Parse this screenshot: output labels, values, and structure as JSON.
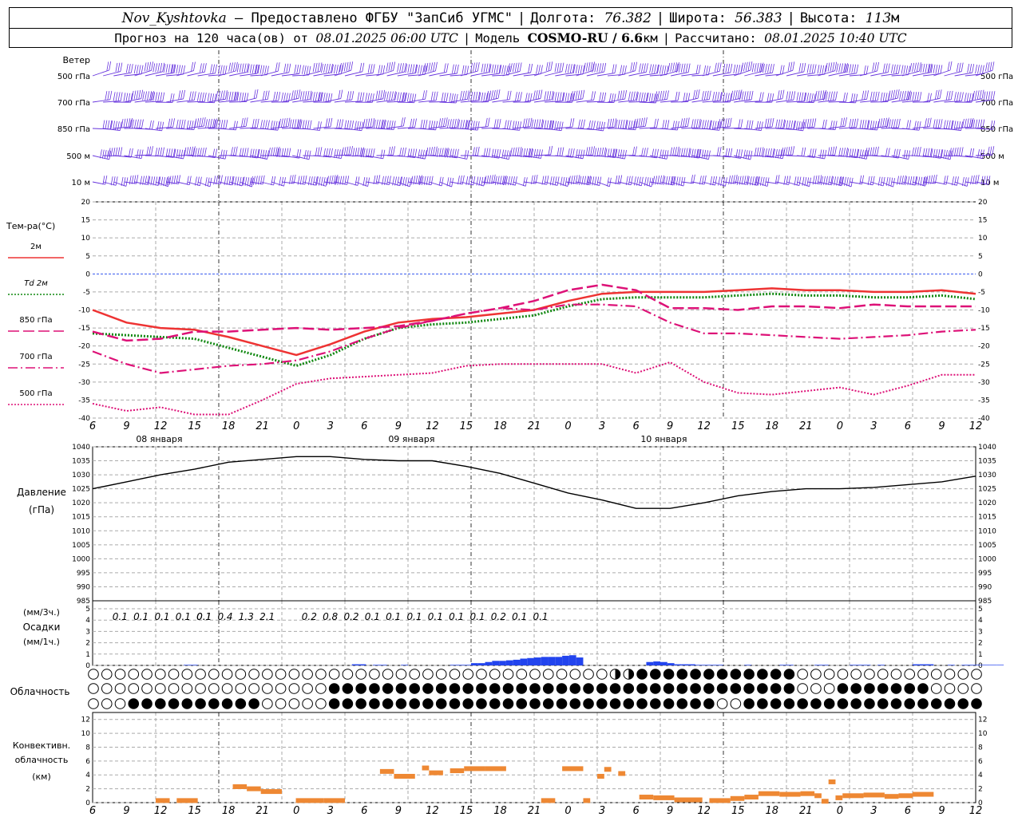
{
  "header": {
    "station": "Nov_Kyshtovka",
    "provider": "— Предоставлено ФГБУ \"ЗапСиб УГМС\"",
    "lon_label": "Долгота:",
    "lon": "76.382",
    "lat_label": "Широта:",
    "lat": "56.383",
    "alt_label": "Высота:",
    "alt": "113",
    "alt_unit": "м",
    "forecast_label": "Прогноз на 120 часа(ов) от",
    "forecast_start": "08.01.2025 06:00 UTC",
    "model_label": "Модель",
    "model": "COSMO-RU / 6.6",
    "model_unit": "км",
    "calc_label": "Рассчитано:",
    "calc_time": "08.01.2025 10:40 UTC"
  },
  "chart_data": [
    {
      "type": "barbs",
      "panel": "wind",
      "title": "Ветер",
      "levels": [
        "500 гПа",
        "700 гПа",
        "850 гПа",
        "500 м",
        "10  м"
      ],
      "x_hours": [
        6,
        9,
        12,
        15,
        18,
        21,
        0,
        3,
        6,
        9,
        12,
        15,
        18,
        21,
        0,
        3,
        6,
        9,
        12,
        15,
        18,
        21,
        0,
        3,
        6,
        9,
        12
      ]
    },
    {
      "type": "line",
      "panel": "temperature",
      "title": "Тем-ра(°С)",
      "ylim": [
        -40,
        20
      ],
      "yticks": [
        20,
        15,
        10,
        5,
        0,
        -5,
        -10,
        -15,
        -20,
        -25,
        -30,
        -35,
        -40
      ],
      "x_hours": [
        6,
        9,
        12,
        15,
        18,
        21,
        0,
        3,
        6,
        9,
        12,
        15,
        18,
        21,
        0,
        3,
        6,
        9,
        12,
        15,
        18,
        21,
        0,
        3,
        6,
        9,
        12
      ],
      "day_labels": [
        "08 января",
        "09 января",
        "10 января"
      ],
      "series": [
        {
          "name": "2м",
          "color": "#ee3333",
          "style": "solid",
          "values": [
            -10,
            -13.5,
            -15,
            -15.5,
            -17.5,
            -20,
            -22.5,
            -19.5,
            -16,
            -13.5,
            -12.5,
            -12,
            -11,
            -10,
            -7.5,
            -5.5,
            -5,
            -5,
            -5,
            -4.5,
            -4,
            -4.5,
            -4.5,
            -5,
            -5,
            -4.5,
            -5.5
          ]
        },
        {
          "name": "Td 2м",
          "color": "#118811",
          "style": "dotted",
          "values": [
            -16.5,
            -17,
            -17.5,
            -18,
            -20.5,
            -23,
            -25.5,
            -22.5,
            -18,
            -15,
            -14,
            -13.5,
            -12.5,
            -11.5,
            -9,
            -7,
            -6.5,
            -6.5,
            -6.5,
            -6,
            -5.5,
            -6,
            -6,
            -6.5,
            -6.5,
            -6,
            -7
          ]
        },
        {
          "name": "850 гПа",
          "color": "#dd1177",
          "style": "longdash",
          "values": [
            -16,
            -18.5,
            -18,
            -16,
            -16,
            -15.5,
            -15,
            -15.5,
            -15,
            -14.5,
            -13,
            -11,
            -9.5,
            -7.5,
            -4.5,
            -3,
            -4.5,
            -9.5,
            -9.5,
            -10,
            -9,
            -9,
            -9.5,
            -8.5,
            -9,
            -9,
            -9
          ]
        },
        {
          "name": "700 гПа",
          "color": "#dd1177",
          "style": "dashdot",
          "values": [
            -21.5,
            -25,
            -27.5,
            -26.5,
            -25.5,
            -25,
            -24,
            -21.5,
            -18,
            -15,
            -13,
            -11,
            -9.5,
            -10,
            -8.5,
            -8.5,
            -9,
            -13.5,
            -16.5,
            -16.5,
            -17,
            -17.5,
            -18,
            -17.5,
            -17,
            -16,
            -15.5
          ]
        },
        {
          "name": "500 гПа",
          "color": "#dd1177",
          "style": "dotted",
          "values": [
            -36,
            -38,
            -37,
            -39,
            -39,
            -35,
            -30.5,
            -29,
            -28.5,
            -28,
            -27.5,
            -25.5,
            -25,
            -25,
            -25,
            -25,
            -27.5,
            -24.5,
            -30,
            -33,
            -33.5,
            -32.5,
            -31.5,
            -33.5,
            -31,
            -28,
            -28
          ]
        }
      ]
    },
    {
      "type": "line",
      "panel": "pressure",
      "title": "Давление",
      "unit": "(гПа)",
      "ylim": [
        985,
        1040
      ],
      "yticks": [
        1040,
        1035,
        1030,
        1025,
        1020,
        1015,
        1010,
        1005,
        1000,
        995,
        990,
        985
      ],
      "series": [
        {
          "name": "Давление",
          "color": "#000000",
          "values": [
            1025,
            1027.5,
            1030,
            1032,
            1034.5,
            1035.5,
            1036.5,
            1036.5,
            1035.5,
            1035,
            1035,
            1033,
            1030.5,
            1027,
            1023.5,
            1021,
            1018,
            1018,
            1020,
            1022.5,
            1024,
            1025,
            1025,
            1025.5,
            1026.5,
            1027.5,
            1029.5
          ]
        }
      ]
    },
    {
      "type": "bar",
      "panel": "precipitation",
      "title": "Осадки",
      "unit_3h": "(мм/3ч.)",
      "unit_1h": "(мм/1ч.)",
      "ylim": [
        0,
        5
      ],
      "yticks": [
        5,
        4,
        3,
        2,
        1,
        0
      ],
      "color": "#2244ee",
      "hourly": [
        0,
        0,
        0,
        0,
        0,
        0,
        0,
        0,
        0,
        0,
        0,
        0,
        0,
        0.05,
        0.05,
        0,
        0,
        0,
        0,
        0,
        0,
        0,
        0,
        0,
        0,
        0,
        0,
        0,
        0,
        0,
        0,
        0,
        0,
        0,
        0,
        0,
        0,
        0.1,
        0.1,
        0,
        0.05,
        0.05,
        0,
        0,
        0.05,
        0,
        0,
        0,
        0,
        0,
        0,
        0.05,
        0.05,
        0.05,
        0.2,
        0.2,
        0.3,
        0.4,
        0.4,
        0.45,
        0.5,
        0.6,
        0.65,
        0.7,
        0.75,
        0.75,
        0.75,
        0.85,
        0.9,
        0.7,
        0,
        0,
        0,
        0,
        0,
        0,
        0,
        0,
        0,
        0.3,
        0.35,
        0.3,
        0.2,
        0.1,
        0.1,
        0.1,
        0.05,
        0.05,
        0.05,
        0.05,
        0,
        0,
        0,
        0.05,
        0,
        0,
        0,
        0,
        0.05,
        0.05,
        0,
        0,
        0,
        0.05,
        0.05,
        0,
        0,
        0,
        0.05,
        0.05,
        0.05,
        0,
        0.05,
        0,
        0,
        0,
        0,
        0.1,
        0.1,
        0.1,
        0,
        0,
        0.05,
        0,
        0.05,
        0.05,
        0.05,
        0.05,
        0.05,
        0.05
      ],
      "sums_3h": [
        "0.1",
        "0.1",
        "0.1",
        "0.1",
        "0.1",
        "0.1",
        "0.4",
        "1.3",
        "2.1",
        "0.2",
        "0.8",
        "0.2",
        "0.1",
        "0.1",
        "0.1",
        "0.1",
        "0.1",
        "0.1",
        "0.2",
        "0.1",
        "0.1"
      ],
      "sums_3h_hour": [
        12,
        15,
        3,
        6,
        9,
        15,
        18,
        21,
        24,
        30,
        33,
        36,
        39,
        42,
        45,
        48,
        51,
        54,
        57,
        60,
        63
      ]
    },
    {
      "type": "table",
      "panel": "cloudiness",
      "title": "Облачность",
      "rows": [
        [
          0,
          0,
          0,
          0,
          0,
          0,
          0,
          0,
          0,
          0,
          0,
          0,
          0,
          0,
          0,
          0,
          0,
          0,
          0,
          0,
          0,
          0,
          0,
          0,
          0,
          0,
          0,
          0,
          0,
          0,
          0,
          0,
          0,
          0,
          0,
          0,
          0,
          0,
          0,
          0,
          0,
          0,
          0,
          0,
          0,
          0,
          0,
          0,
          0,
          0,
          0,
          0,
          0,
          0,
          0,
          0,
          0,
          0,
          0,
          0,
          0,
          0,
          0,
          0,
          0,
          0,
          0,
          0,
          0,
          0,
          0,
          0,
          0,
          0,
          0,
          0,
          0,
          0,
          0,
          0,
          0,
          0,
          0,
          0,
          0,
          0,
          0,
          0,
          0,
          0,
          0,
          0,
          0,
          0,
          0,
          0,
          0,
          0,
          0,
          0,
          0,
          0,
          0,
          0,
          0,
          0,
          0,
          0,
          0,
          0,
          0,
          0,
          0,
          0,
          0,
          0,
          0,
          0,
          0,
          0,
          0,
          0,
          0,
          0,
          0,
          0
        ],
        [
          0,
          0,
          0,
          0,
          0,
          0,
          0,
          0,
          0,
          0,
          0,
          0,
          0,
          0,
          0,
          0,
          0,
          0,
          0,
          0,
          0,
          0,
          0,
          0,
          0,
          0,
          0,
          0,
          0,
          0,
          0,
          0,
          0,
          0,
          0,
          0,
          0,
          0,
          0,
          0,
          0,
          0,
          0,
          0,
          0,
          0,
          0,
          0,
          0,
          0,
          0,
          0,
          0,
          0,
          0,
          0,
          0,
          0,
          0,
          0,
          0,
          0,
          0,
          0,
          0,
          0,
          0,
          0,
          0,
          0,
          0,
          0,
          0,
          0,
          0,
          0,
          0,
          0,
          0,
          0,
          0,
          0,
          0,
          0,
          0,
          0,
          0,
          0,
          0,
          0,
          0,
          0,
          0,
          0,
          0,
          0,
          0,
          0,
          0,
          0,
          0,
          0,
          0,
          0,
          0,
          0,
          0,
          0,
          0,
          0,
          0,
          0,
          0,
          0,
          0,
          0,
          0,
          0,
          0,
          0,
          0,
          0,
          0,
          0,
          0,
          0
        ],
        [
          0,
          0,
          0,
          0,
          0,
          0,
          0,
          0,
          0,
          0,
          0,
          0,
          0,
          0,
          0,
          0,
          0,
          0,
          0,
          0,
          0,
          0,
          0,
          0,
          0,
          0,
          0,
          0,
          0,
          0,
          0,
          0,
          0,
          0,
          0,
          0,
          0,
          0,
          0,
          0,
          0,
          0,
          0,
          0,
          0,
          0,
          0,
          0,
          0,
          0,
          0,
          0,
          0,
          0,
          0,
          0,
          0,
          0,
          0,
          0,
          0,
          0,
          0,
          0,
          0,
          0,
          0,
          0,
          0,
          0,
          0,
          0,
          0,
          0,
          0,
          0,
          0,
          0,
          0,
          0,
          0,
          0,
          0,
          0,
          0,
          0,
          0,
          0,
          0,
          0,
          0,
          0,
          0,
          0,
          0,
          0,
          0,
          0,
          0,
          0,
          0,
          0,
          0,
          0,
          0,
          0,
          0,
          0,
          0,
          0,
          0,
          0,
          0,
          0,
          0,
          0,
          0,
          0,
          0,
          0,
          0,
          0,
          0,
          0,
          0,
          0
        ]
      ]
    },
    {
      "type": "bar",
      "panel": "convective",
      "title": "Конвективн.",
      "title2": "облачность",
      "unit": "(км)",
      "ylim": [
        0,
        13
      ],
      "yticks": [
        12,
        10,
        8,
        6,
        4,
        2,
        0
      ],
      "color": "#ee8833",
      "x_hours": [
        6,
        9,
        12,
        15,
        18,
        21,
        0,
        3,
        6,
        9,
        12,
        15,
        18,
        21,
        0,
        3,
        6,
        9,
        12,
        15,
        18,
        21,
        0,
        3,
        6,
        9,
        12
      ],
      "segments": [
        [
          9,
          11,
          0.3
        ],
        [
          12,
          15,
          0.3
        ],
        [
          20,
          22,
          2.3
        ],
        [
          22,
          24,
          2
        ],
        [
          24,
          27,
          1.6
        ],
        [
          29,
          33,
          0.3
        ],
        [
          33,
          36,
          0.3
        ],
        [
          41,
          43,
          4.5
        ],
        [
          43,
          46,
          3.8
        ],
        [
          47,
          48,
          5
        ],
        [
          48,
          50,
          4.3
        ],
        [
          51,
          53,
          4.6
        ],
        [
          53,
          56,
          4.9
        ],
        [
          56,
          59,
          4.9
        ],
        [
          64,
          66,
          0.3
        ],
        [
          67,
          70,
          4.9
        ],
        [
          70,
          71,
          0.3
        ],
        [
          72,
          73,
          3.8
        ],
        [
          73,
          74,
          4.8
        ],
        [
          75,
          76,
          4.2
        ],
        [
          78,
          80,
          0.8
        ],
        [
          80,
          83,
          0.7
        ],
        [
          83,
          87,
          0.4
        ],
        [
          88,
          91,
          0.3
        ],
        [
          91,
          93,
          0.6
        ],
        [
          93,
          95,
          0.8
        ],
        [
          95,
          98,
          1.3
        ],
        [
          98,
          101,
          1.2
        ],
        [
          101,
          103,
          1.3
        ],
        [
          103,
          104,
          1
        ],
        [
          104,
          105,
          0.2
        ],
        [
          105,
          106,
          3
        ],
        [
          106,
          107,
          0.7
        ],
        [
          107,
          110,
          1
        ],
        [
          110,
          113,
          1.1
        ],
        [
          113,
          115,
          0.9
        ],
        [
          115,
          117,
          1
        ],
        [
          117,
          120,
          1.2
        ]
      ]
    }
  ]
}
